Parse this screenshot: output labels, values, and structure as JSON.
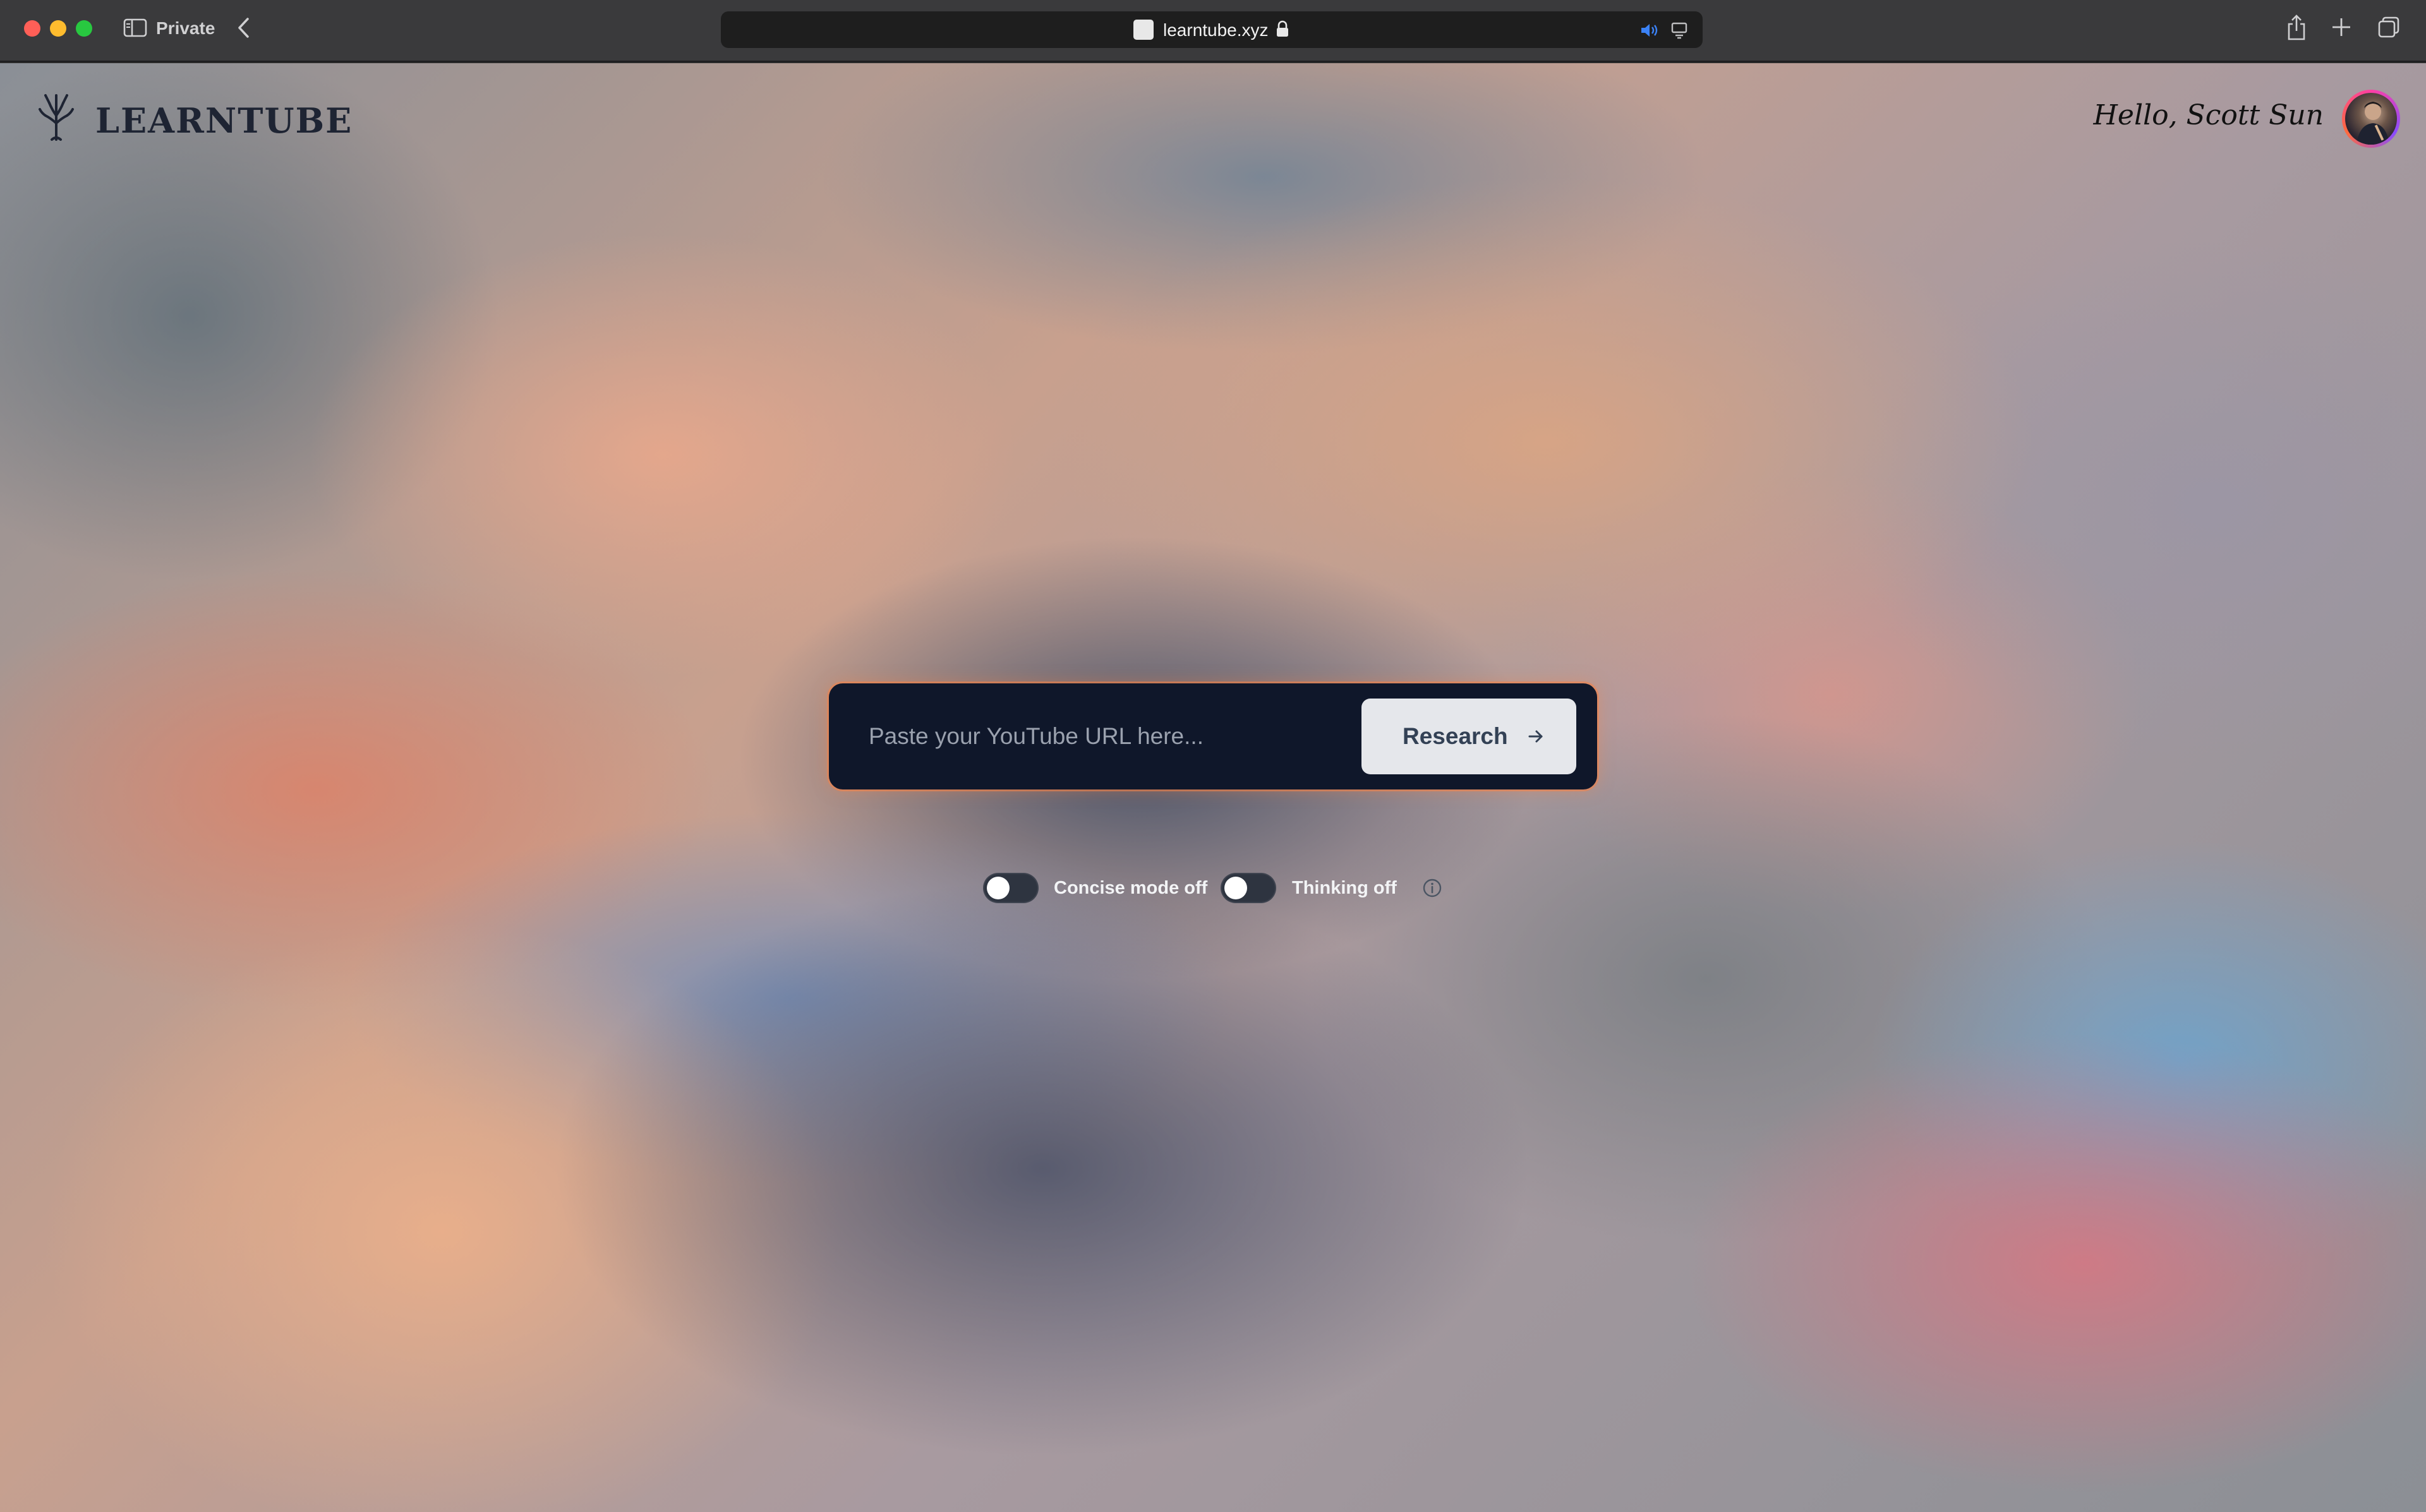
{
  "browser": {
    "mode_label": "Private",
    "url": "learntube.xyz"
  },
  "site": {
    "brand_name": "LEARNTUBE",
    "greeting": "Hello, Scott Sun"
  },
  "search": {
    "placeholder": "Paste your YouTube URL here...",
    "value": "",
    "button_label": "Research"
  },
  "toggles": [
    {
      "label": "Concise mode off",
      "on": false
    },
    {
      "label": "Thinking off",
      "on": false
    }
  ],
  "colors": {
    "search_bg": "#0f172a",
    "search_glow": "#f68246",
    "button_bg": "#e5e7eb",
    "button_text": "#334155",
    "avatar_ring": "#ff3fa4"
  }
}
